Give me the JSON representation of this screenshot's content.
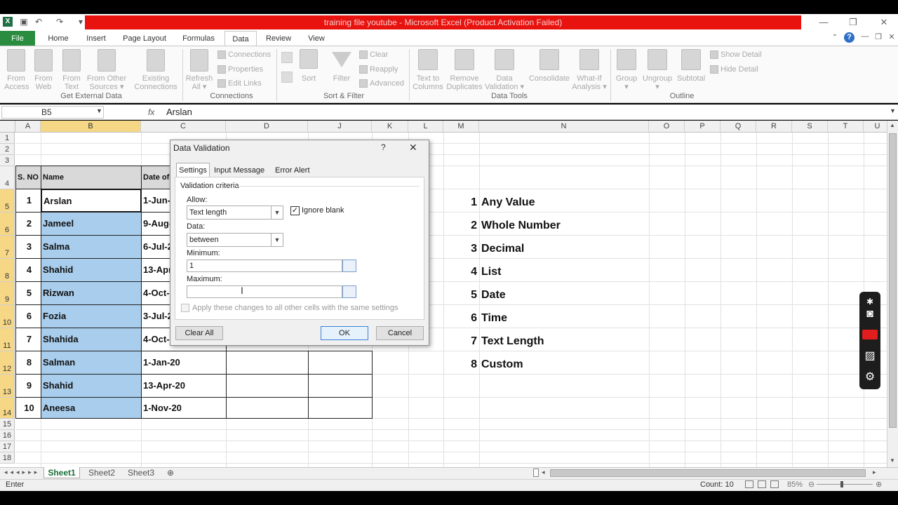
{
  "window": {
    "title": "training file youtube  -  Microsoft Excel (Product Activation Failed)"
  },
  "ribbon_tabs": [
    "File",
    "Home",
    "Insert",
    "Page Layout",
    "Formulas",
    "Data",
    "Review",
    "View"
  ],
  "ribbon": {
    "get_external": {
      "buttons": [
        [
          "From",
          "Access"
        ],
        [
          "From",
          "Web"
        ],
        [
          "From",
          "Text"
        ],
        [
          "From Other",
          "Sources ▾"
        ],
        [
          "Existing",
          "Connections"
        ]
      ],
      "label": "Get External Data"
    },
    "connections": {
      "refresh": [
        "Refresh",
        "All ▾"
      ],
      "items": [
        "Connections",
        "Properties",
        "Edit Links"
      ],
      "label": "Connections"
    },
    "sort_filter": {
      "sort": "Sort",
      "filter": "Filter",
      "items": [
        "Clear",
        "Reapply",
        "Advanced"
      ],
      "label": "Sort & Filter"
    },
    "data_tools": {
      "buttons": [
        [
          "Text to",
          "Columns"
        ],
        [
          "Remove",
          "Duplicates"
        ],
        [
          "Data",
          "Validation ▾"
        ],
        [
          "Consolidate",
          ""
        ],
        [
          "What-If",
          "Analysis ▾"
        ]
      ],
      "label": "Data Tools"
    },
    "outline": {
      "buttons": [
        [
          "Group",
          "▾"
        ],
        [
          "Ungroup",
          "▾"
        ],
        [
          "Subtotal",
          ""
        ]
      ],
      "items": [
        "Show Detail",
        "Hide Detail"
      ],
      "label": "Outline"
    }
  },
  "formula_bar": {
    "name_box": "B5",
    "fx": "fx",
    "content": "Arslan"
  },
  "columns": [
    "A",
    "B",
    "C",
    "D",
    "J",
    "K",
    "L",
    "M",
    "N",
    "O",
    "P",
    "Q",
    "R",
    "S",
    "T",
    "U"
  ],
  "rows": [
    "1",
    "2",
    "3",
    "4",
    "5",
    "6",
    "7",
    "8",
    "9",
    "10",
    "11",
    "12",
    "13",
    "14",
    "15",
    "16",
    "17",
    "18"
  ],
  "table": {
    "headers": [
      "S. NO",
      "Name",
      "Date of J"
    ],
    "rows": [
      [
        "1",
        "Arslan",
        "1-Jun-"
      ],
      [
        "2",
        "Jameel",
        "9-Aug-"
      ],
      [
        "3",
        "Salma",
        "6-Jul-2"
      ],
      [
        "4",
        "Shahid",
        "13-Apr"
      ],
      [
        "5",
        "Rizwan",
        "4-Oct-"
      ],
      [
        "6",
        "Fozia",
        "3-Jul-2"
      ],
      [
        "7",
        "Shahida",
        "4-Oct-"
      ],
      [
        "8",
        "Salman",
        "1-Jan-20"
      ],
      [
        "9",
        "Shahid",
        "13-Apr-20"
      ],
      [
        "10",
        "Aneesa",
        "1-Nov-20"
      ]
    ]
  },
  "type_list": [
    [
      "1",
      "Any Value"
    ],
    [
      "2",
      "Whole Number"
    ],
    [
      "3",
      "Decimal"
    ],
    [
      "4",
      "List"
    ],
    [
      "5",
      "Date"
    ],
    [
      "6",
      "Time"
    ],
    [
      "7",
      "Text Length"
    ],
    [
      "8",
      "Custom"
    ]
  ],
  "dialog": {
    "title": "Data Validation",
    "help": "?",
    "close": "✕",
    "tabs": [
      "Settings",
      "Input Message",
      "Error Alert"
    ],
    "section": "Validation criteria",
    "allow_label": "Allow:",
    "allow_value": "Text length",
    "ignore_blank": "Ignore blank",
    "data_label": "Data:",
    "data_value": "between",
    "minimum_label": "Minimum:",
    "minimum_value": "1",
    "maximum_label": "Maximum:",
    "maximum_value": "",
    "apply_all": "Apply these changes to all other cells with the same settings",
    "clear_all": "Clear All",
    "ok": "OK",
    "cancel": "Cancel"
  },
  "sheets": [
    "Sheet1",
    "Sheet2",
    "Sheet3"
  ],
  "status": {
    "mode": "Enter",
    "count": "Count: 10",
    "zoom": "85%"
  },
  "colors": {
    "file_tab": "#2a8c3f",
    "title_bar": "#e8120e",
    "selected_header": "#f5d786",
    "selection_fill": "#a9cdec"
  }
}
